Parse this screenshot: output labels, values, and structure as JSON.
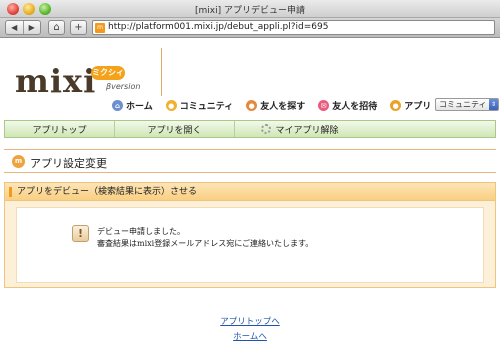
{
  "window": {
    "title": "[mixi] アプリデビュー申請"
  },
  "toolbar": {
    "back": "◀",
    "forward": "▶",
    "home": "⌂",
    "add": "+",
    "favicon": "m",
    "url": "http://platform001.mixi.jp/debut_appli.pl?id=695"
  },
  "header": {
    "logo": "mixi",
    "badge": "ミクシィ",
    "beta": "βversion",
    "nav": [
      {
        "label": "ホーム",
        "icon": "home-icon"
      },
      {
        "label": "コミュニティ",
        "icon": "community-icon"
      },
      {
        "label": "友人を探す",
        "icon": "find-friend-icon"
      },
      {
        "label": "友人を招待",
        "icon": "invite-icon"
      },
      {
        "label": "アプリ",
        "icon": "app-icon"
      }
    ],
    "search_select": "コミュニティ"
  },
  "subnav": [
    {
      "label": "アプリトップ"
    },
    {
      "label": "アプリを開く"
    },
    {
      "label": "マイアプリ解除",
      "icon": "gear-icon"
    }
  ],
  "page": {
    "title": "アプリ設定変更",
    "section_title": "アプリをデビュー（検索結果に表示）させる",
    "message_line1": "デビュー申請しました。",
    "message_line2": "審査結果はmixi登録メールアドレス宛にご連絡いたします。"
  },
  "links": {
    "app_top": "アプリトップへ",
    "home": "ホームへ"
  }
}
